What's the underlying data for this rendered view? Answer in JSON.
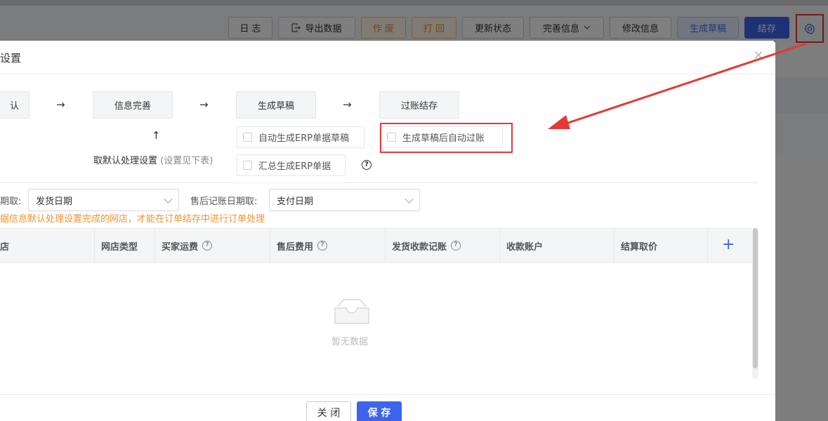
{
  "toolbar": {
    "log": "日 志",
    "export": "导出数据",
    "void": "作 废",
    "reopen": "打 回",
    "update_status": "更新状态",
    "complete_info": "完善信息",
    "modify_info": "修改信息",
    "generate_draft": "生成草稿",
    "post": "结存",
    "settings_icon": "gear-icon"
  },
  "modal": {
    "title": "设置",
    "close_icon": "close-icon",
    "steps": [
      "认",
      "信息完善",
      "生成草稿",
      "过账结存"
    ],
    "checkboxes": {
      "auto_generate_erp_draft": "自动生成ERP单据草稿",
      "auto_post_after_draft": "生成草稿后自动过账",
      "summary_generate_erp": "汇总生成ERP单据"
    },
    "default_handling": "取默认处理设置",
    "default_handling_hint": "(设置见下表)",
    "date_label_1": "期取:",
    "date_value_1": "发货日期",
    "date_label_2": "售后记账日期取:",
    "date_value_2": "支付日期",
    "warning": "据信息默认处理设置完成的网店，才能在订单结存中进行订单处理",
    "table": {
      "columns": [
        "店",
        "网店类型",
        "买家运费",
        "售后费用",
        "发货收款记账",
        "收款账户",
        "结算取价"
      ],
      "add_icon": "plus-icon",
      "empty_text": "暂无数据"
    },
    "footer": {
      "close": "关 闭",
      "save": "保 存"
    }
  },
  "colors": {
    "primary": "#3e63ec",
    "warning": "#f0922e",
    "annotation": "#e53935"
  }
}
